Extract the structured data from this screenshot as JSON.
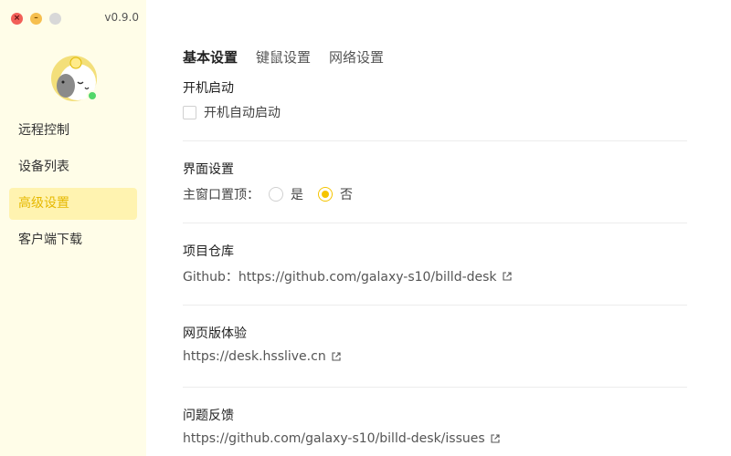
{
  "window": {
    "version": "v0.9.0"
  },
  "sidebar": {
    "items": [
      {
        "label": "远程控制"
      },
      {
        "label": "设备列表"
      },
      {
        "label": "高级设置",
        "active": true
      },
      {
        "label": "客户端下载"
      }
    ]
  },
  "tabs": [
    {
      "label": "基本设置",
      "active": true
    },
    {
      "label": "键鼠设置"
    },
    {
      "label": "网络设置"
    }
  ],
  "sections": {
    "startup": {
      "title": "开机启动",
      "checkbox_label": "开机自动启动",
      "checked": false
    },
    "interface": {
      "title": "界面设置",
      "label": "主窗口置顶：",
      "options": [
        "是",
        "否"
      ],
      "selected": "否"
    },
    "repo": {
      "title": "项目仓库",
      "text": "Github：https://github.com/galaxy-s10/billd-desk"
    },
    "web": {
      "title": "网页版体验",
      "text": "https://desk.hsslive.cn"
    },
    "feedback": {
      "title": "问题反馈",
      "text": "https://github.com/galaxy-s10/billd-desk/issues"
    }
  },
  "colors": {
    "accent": "#f5c400",
    "sidebar_bg": "#fffde8",
    "active_bg": "#fff3b0",
    "online": "#53d769"
  },
  "icons": {
    "close": "close-icon",
    "minimize": "minimize-icon",
    "maximize": "maximize-icon",
    "external": "external-link-icon"
  }
}
